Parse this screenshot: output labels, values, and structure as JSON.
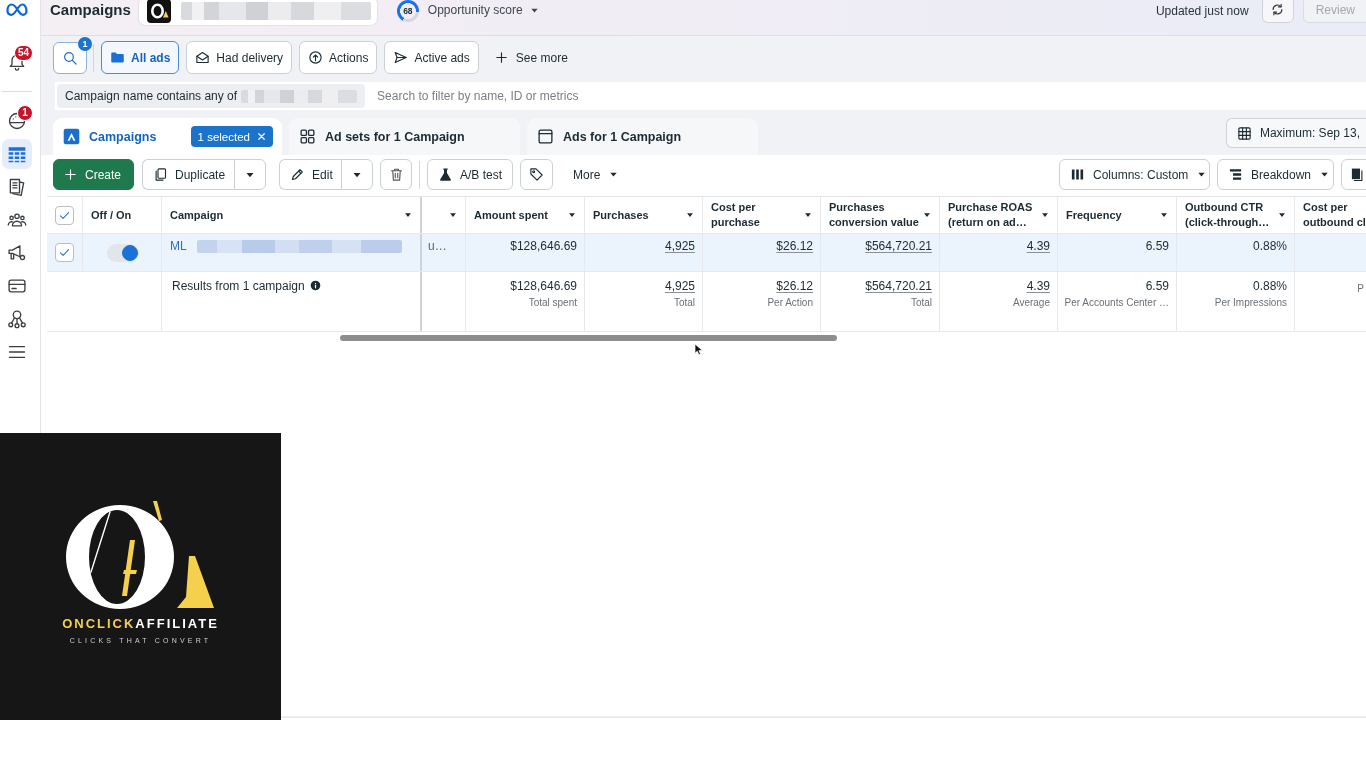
{
  "sidebar": {
    "items": [
      {
        "selected": false,
        "badge": "54"
      },
      {
        "selected": false,
        "badge": "1"
      },
      {
        "selected": true
      },
      {
        "selected": false
      },
      {
        "selected": false
      },
      {
        "selected": false
      },
      {
        "selected": false
      },
      {
        "selected": false
      },
      {
        "selected": false
      }
    ]
  },
  "top_bar": {
    "title": "Campaigns",
    "account": {
      "blurred": true
    },
    "opportunity_score": {
      "score": "68",
      "label": "Opportunity score"
    },
    "updated_text": "Updated just now",
    "review_button": {
      "label": "Review",
      "disabled": true
    }
  },
  "quick_filters": {
    "search_badge": "1",
    "items": [
      {
        "label": "All ads",
        "selected": true
      },
      {
        "label": "Had delivery",
        "selected": false
      },
      {
        "label": "Actions",
        "selected": false
      },
      {
        "label": "Active ads",
        "selected": false
      }
    ],
    "see_more": "See more"
  },
  "filter_bar": {
    "chip_label": "Campaign name contains any of",
    "chip_value_blurred": true,
    "placeholder": "Search to filter by name, ID or metrics"
  },
  "level_tabs": [
    {
      "label": "Campaigns",
      "selected": true,
      "selection_badge": "1 selected"
    },
    {
      "label": "Ad sets for 1 Campaign",
      "selected": false
    },
    {
      "label": "Ads for 1 Campaign",
      "selected": false
    }
  ],
  "date_range": "Maximum: Sep 13,",
  "toolbar": {
    "create": "Create",
    "duplicate": "Duplicate",
    "edit": "Edit",
    "ab_test": "A/B test",
    "more": "More",
    "columns": "Columns: Custom",
    "breakdown": "Breakdown"
  },
  "table": {
    "select_all_checked": true,
    "columns": [
      {
        "kind": "toggle",
        "label": "Off / On",
        "dropdown": false
      },
      {
        "kind": "name",
        "label": "Campaign",
        "dropdown": true
      },
      {
        "kind": "text",
        "dropdown": true
      },
      {
        "kind": "metric",
        "label": "Amount spent",
        "dropdown": true
      },
      {
        "kind": "metric",
        "label": "Purchases",
        "dropdown": true
      },
      {
        "kind": "metric",
        "label": "Cost per purchase",
        "dropdown": true
      },
      {
        "kind": "metric",
        "label": "Purchases conversion value",
        "dropdown": true
      },
      {
        "kind": "metric",
        "label": "Purchase ROAS (return on ad…",
        "dropdown": true
      },
      {
        "kind": "metric",
        "label": "Frequency",
        "dropdown": true
      },
      {
        "kind": "metric",
        "label": "Outbound CTR (click-through…",
        "dropdown": true
      },
      {
        "kind": "metric",
        "label": "Cost per outbound cl",
        "dropdown": false
      }
    ],
    "rows": [
      {
        "selected": true,
        "checked": true,
        "cells": [
          {
            "on": true
          },
          {
            "text": "ML",
            "blurred": true
          },
          {
            "text": "u…"
          },
          {
            "text": "$128,646.69",
            "underlined": false
          },
          {
            "text": "4,925",
            "underlined": true
          },
          {
            "text": "$26.12",
            "underlined": true
          },
          {
            "text": "$564,720.21",
            "underlined": true
          },
          {
            "text": "4.39",
            "underlined": true
          },
          {
            "text": "6.59",
            "underlined": false
          },
          {
            "text": "0.88%",
            "underlined": false
          }
        ]
      }
    ],
    "summary": {
      "cells": [
        "",
        {
          "text": "Results from 1 campaign"
        },
        "",
        {
          "value": "$128,646.69",
          "note": "Total spent",
          "underlined": false
        },
        {
          "value": "4,925",
          "note": "Total",
          "underlined": true
        },
        {
          "value": "$26.12",
          "note": "Per Action",
          "underlined": true
        },
        {
          "value": "$564,720.21",
          "note": "Total",
          "underlined": true
        },
        {
          "value": "4.39",
          "note": "Average",
          "underlined": true
        },
        {
          "value": "6.59",
          "note": "Per Accounts Center …",
          "underlined": false
        },
        {
          "value": "0.88%",
          "note": "Per Impressions",
          "underlined": false
        },
        {
          "note": "P"
        }
      ]
    }
  },
  "brand_panel": {
    "name_parts": [
      {
        "text": "ONCLICK",
        "color": "#f5d04c"
      },
      {
        "text": "AFFILIATE",
        "color": "#ffffff"
      }
    ],
    "tagline": "CLICKS THAT CONVERT"
  }
}
